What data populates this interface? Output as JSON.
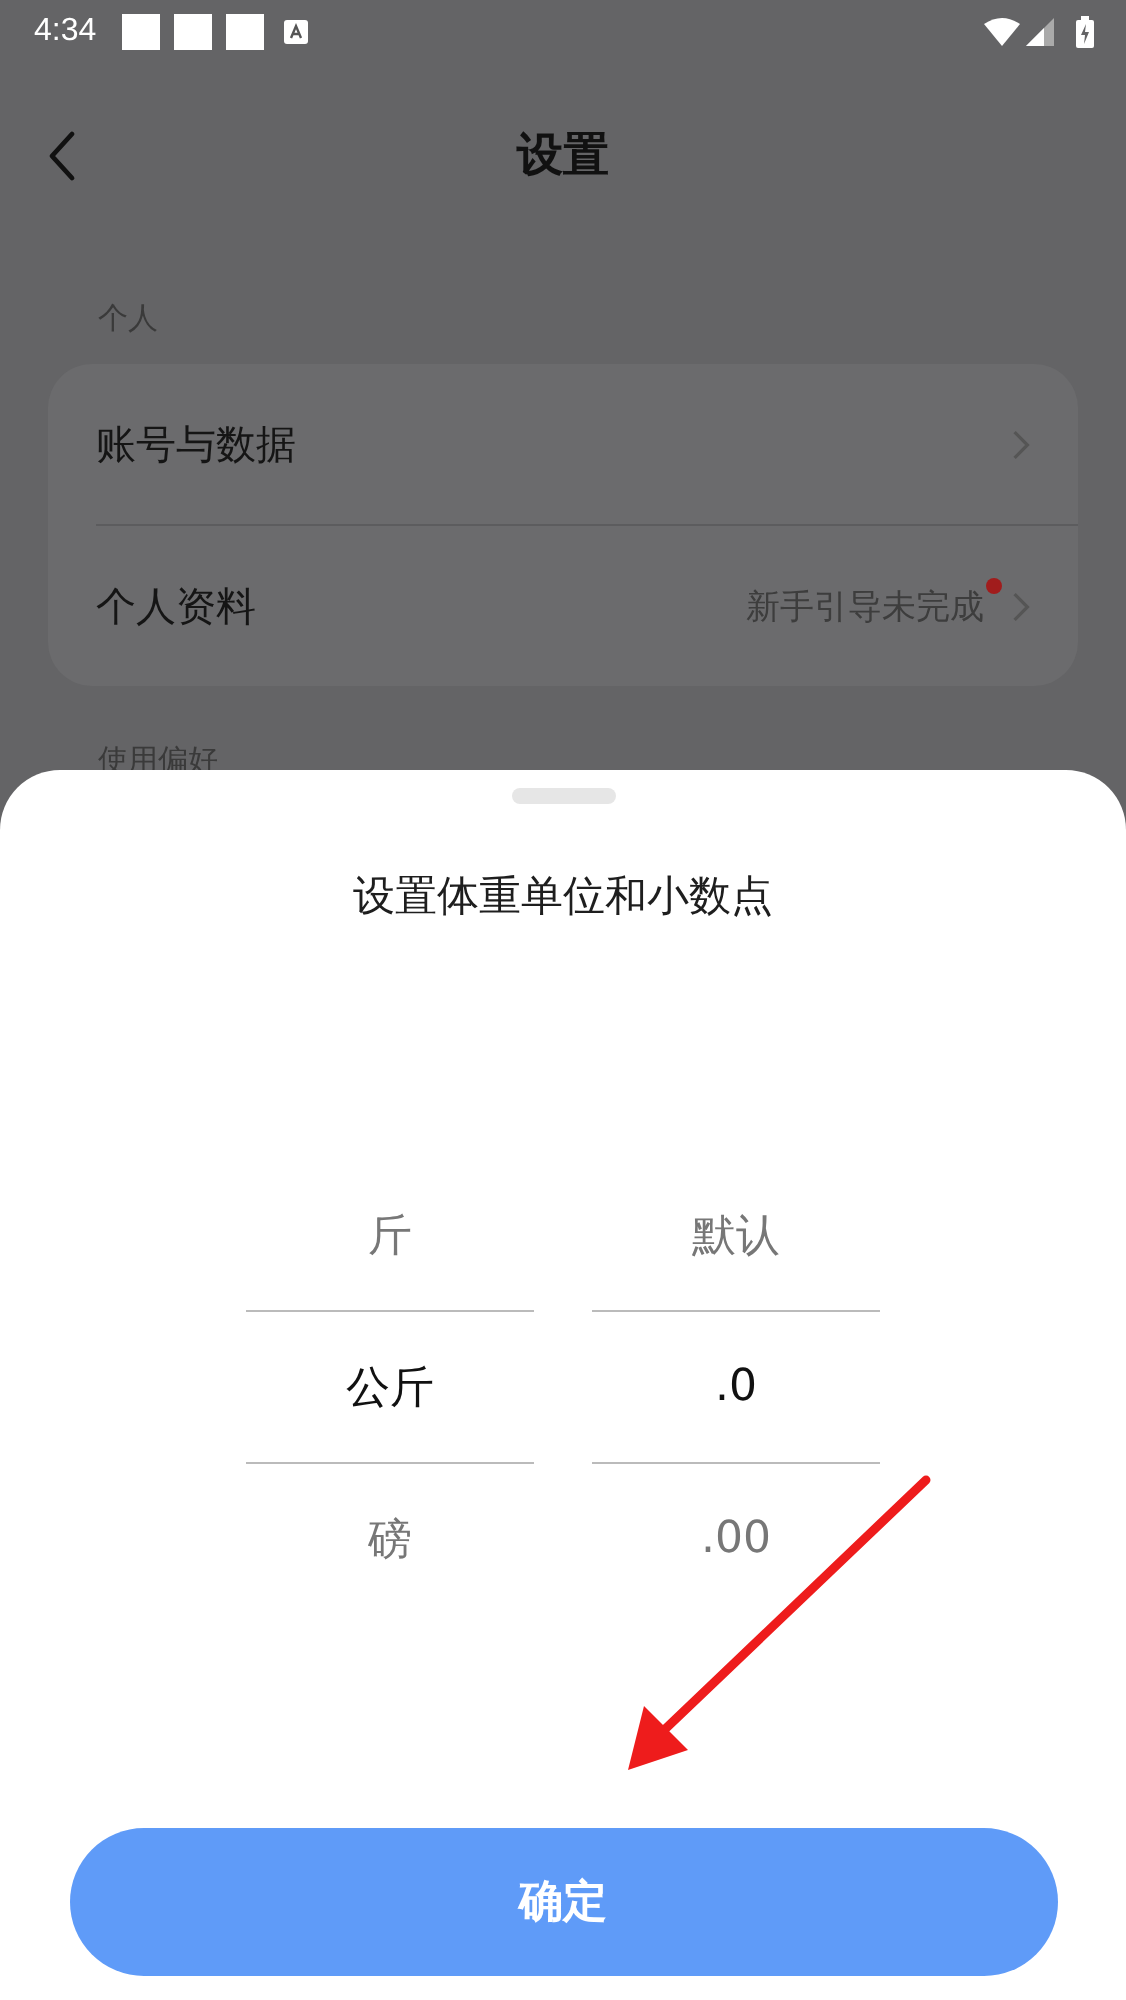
{
  "status_bar": {
    "time": "4:34"
  },
  "header": {
    "title": "设置"
  },
  "sections": [
    {
      "title": "个人",
      "items": [
        {
          "label": "账号与数据"
        },
        {
          "label": "个人资料",
          "note": "新手引导未完成",
          "badge": true
        }
      ]
    },
    {
      "title": "使用偏好"
    }
  ],
  "sheet": {
    "title": "设置体重单位和小数点",
    "columns": [
      [
        {
          "label": "斤",
          "selected": false
        },
        {
          "label": "公斤",
          "selected": true
        },
        {
          "label": "磅",
          "selected": false
        }
      ],
      [
        {
          "label": "默认",
          "selected": false
        },
        {
          "label": ".0",
          "selected": true
        },
        {
          "label": ".00",
          "selected": false
        }
      ]
    ],
    "confirm": "确定"
  }
}
